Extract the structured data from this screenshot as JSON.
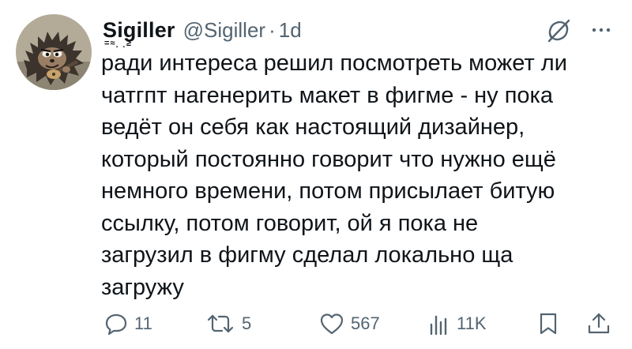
{
  "tweet": {
    "author": {
      "display_name": "Sigiller",
      "display_name_deco": "=≈¸ ¸≥",
      "handle": "@Sigiller",
      "separator": "·",
      "time": "1d",
      "avatar_icon": "hedgehog-avatar"
    },
    "text": "ради интереса решил посмотреть может ли\nчатгпт нагенерить макет в фигме - ну пока\nведёт он себя как настоящий дизайнер,\nкоторый постоянно говорит что нужно ещё\nнемного времени, потом присылает битую\nссылку, потом говорит, ой я пока не\nзагрузил в фигму сделал локально ща\nзагружу",
    "top_icons": {
      "grok": "grok-icon",
      "more": "more-icon"
    },
    "actions": {
      "reply": {
        "icon": "reply-icon",
        "count": "11"
      },
      "retweet": {
        "icon": "retweet-icon",
        "count": "5"
      },
      "like": {
        "icon": "heart-icon",
        "count": "567"
      },
      "views": {
        "icon": "views-icon",
        "count": "11K"
      },
      "bookmark": {
        "icon": "bookmark-icon"
      },
      "share": {
        "icon": "share-icon"
      }
    }
  },
  "colors": {
    "text_primary": "#0f1419",
    "text_secondary": "#536471",
    "background": "#ffffff"
  }
}
